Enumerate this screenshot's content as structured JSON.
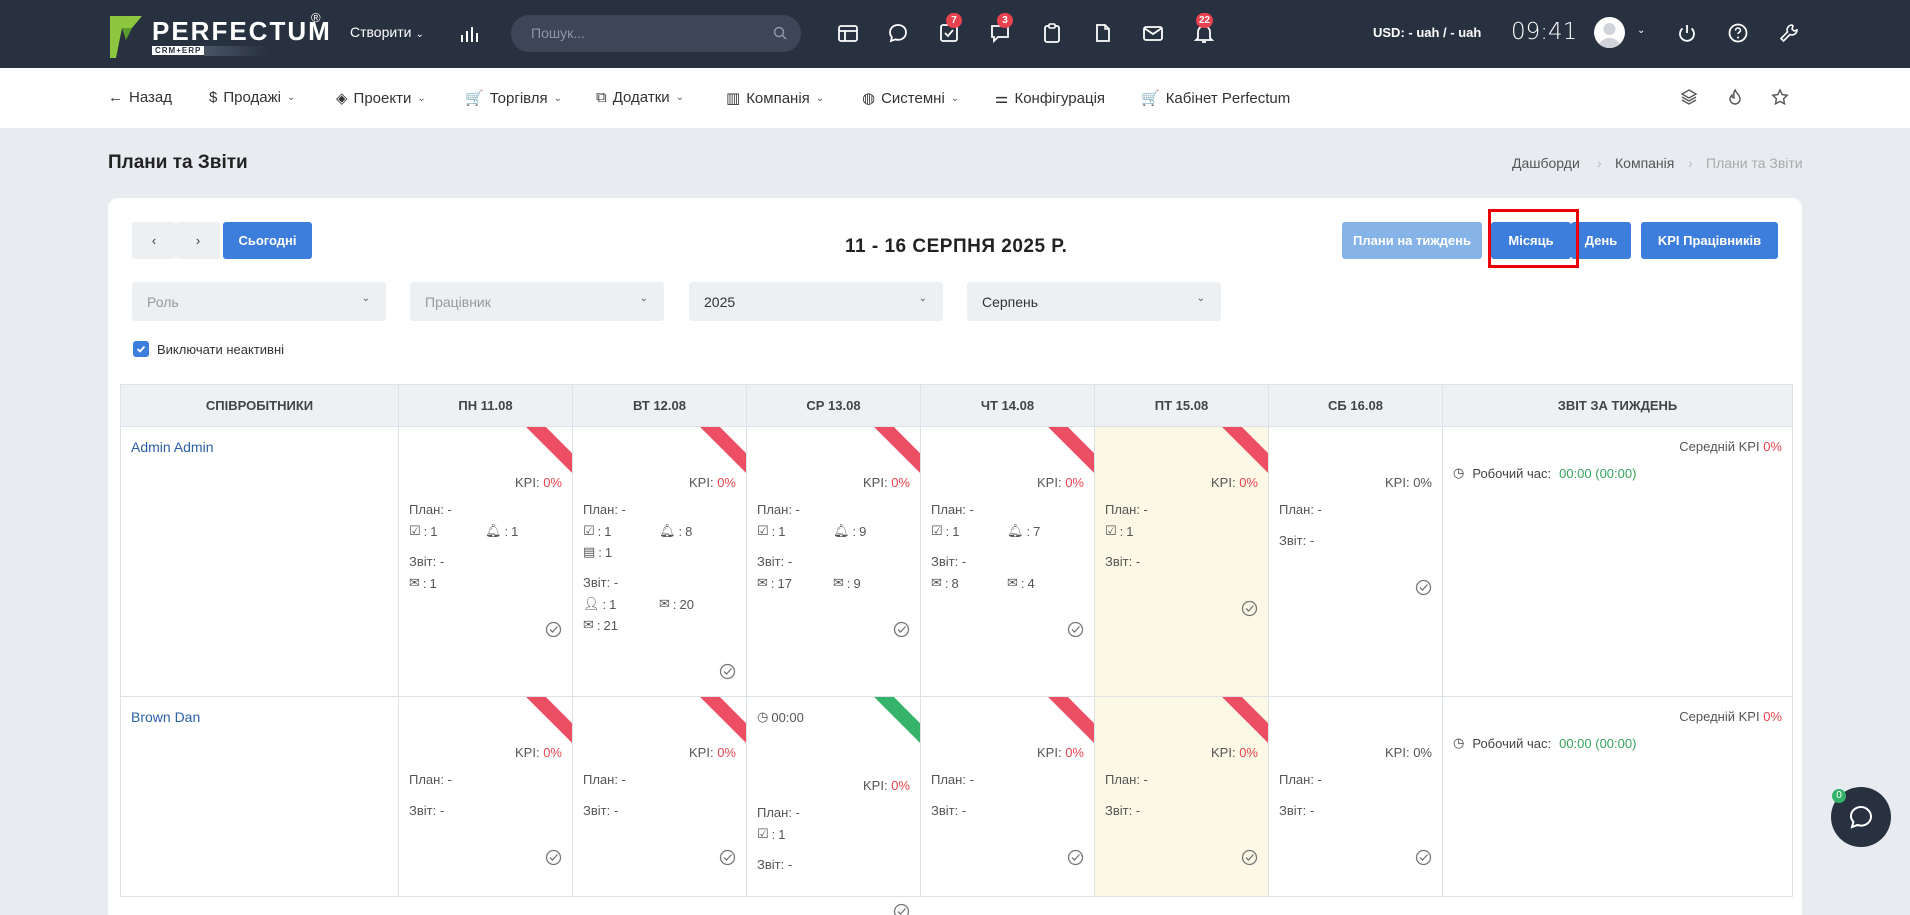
{
  "app": {
    "brand": "PERFECTUM",
    "brand_sub": "CRM+ERP",
    "reg_mark": "®"
  },
  "topbar": {
    "create_label": "Створити",
    "search_placeholder": "Пошук...",
    "badges": {
      "tasks": "7",
      "chat": "3",
      "notifications": "22"
    },
    "currency": "USD: - uah / - uah",
    "time": "09:41"
  },
  "nav": {
    "back": "Назад",
    "sales": "Продажі",
    "projects": "Проекти",
    "trade": "Торгівля",
    "addons": "Додатки",
    "company": "Компанія",
    "system": "Системні",
    "config": "Конфігурація",
    "cabinet": "Кабінет Perfectum"
  },
  "page": {
    "title": "Плани та Звіти",
    "breadcrumbs": [
      "Дашборди",
      "Компанія",
      "Плани та Звіти"
    ]
  },
  "toolbar": {
    "prev": "‹",
    "next": "›",
    "today": "Сьогодні",
    "week_title": "11 - 16 СЕРПНЯ 2025 Р.",
    "week_plans": "Плани на тиждень",
    "month": "Місяць",
    "day": "День",
    "kpi": "KPI Працівників"
  },
  "filters": {
    "role": "Роль",
    "employee": "Працівник",
    "year": "2025",
    "month": "Серпень",
    "exclude_inactive": "Виключати неактивні"
  },
  "table": {
    "headers": [
      "Співробітники",
      "ПН 11.08",
      "ВТ 12.08",
      "СР 13.08",
      "ЧТ 14.08",
      "ПТ 15.08",
      "СБ 16.08",
      "Звіт за тиждень"
    ],
    "kpi_label": "KPI:",
    "kpi_value": "0%",
    "plan_label": "План: -",
    "report_label": "Звіт: -",
    "avg_kpi_label": "Середній KPI",
    "avg_kpi_value": "0%",
    "worktime_label": "Робочий час:",
    "worktime_value": "00:00 (00:00)",
    "rows": [
      {
        "name": "Admin Admin",
        "mon": {
          "tasks": "1",
          "reminders": "1",
          "inbox": "1"
        },
        "tue": {
          "tasks": "1",
          "reminders": "8",
          "events": "1",
          "contacts": "1",
          "mail": "20",
          "inbox": "21"
        },
        "wed": {
          "tasks": "1",
          "reminders": "9",
          "mail": "17",
          "inbox": "9"
        },
        "thu": {
          "tasks": "1",
          "reminders": "7",
          "mail": "8",
          "inbox": "4"
        },
        "fri": {
          "tasks": "1"
        }
      },
      {
        "name": "Brown Dan",
        "wed": {
          "time": "00:00",
          "tasks": "1"
        }
      }
    ]
  },
  "chat_badge": "0"
}
